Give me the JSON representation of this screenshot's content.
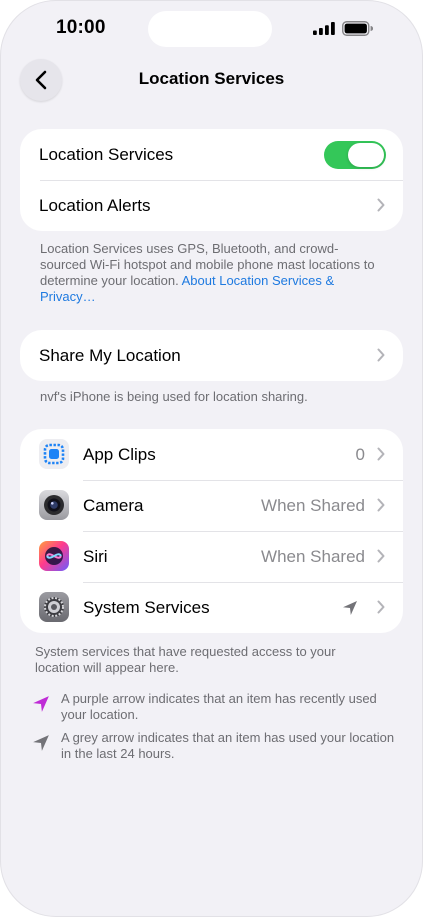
{
  "status_bar": {
    "time": "10:00"
  },
  "nav": {
    "title": "Location Services"
  },
  "location_group": {
    "toggle_label": "Location Services",
    "toggle_on": true,
    "alerts_label": "Location Alerts"
  },
  "location_note": {
    "text": "Location Services uses GPS, Bluetooth, and crowd-sourced Wi-Fi hotspot and mobile phone mast locations to determine your location. ",
    "link": "About Location Services & Privacy…"
  },
  "share": {
    "label": "Share My Location",
    "note": "nvf's iPhone is being used for location sharing."
  },
  "apps": [
    {
      "name": "App Clips",
      "value": "0",
      "icon": "app-clips-icon"
    },
    {
      "name": "Camera",
      "value": "When Shared",
      "icon": "camera-icon"
    },
    {
      "name": "Siri",
      "value": "When Shared",
      "icon": "siri-icon"
    },
    {
      "name": "System Services",
      "value": "",
      "icon": "gear-icon",
      "status_icon": "location-arrow-grey-icon"
    }
  ],
  "system_note": "System services that have requested access to your location will appear here.",
  "legend": [
    {
      "icon": "purple-arrow-icon",
      "text": "A purple arrow indicates that an item has recently used your location."
    },
    {
      "icon": "grey-arrow-icon",
      "text": "A grey arrow indicates that an item has used your location in the last 24 hours."
    }
  ],
  "colors": {
    "background": "#f2f1f6",
    "toggle_on": "#34c759",
    "link": "#1f7ae0",
    "purple_arrow": "#bf2cd6",
    "grey_arrow": "#737378"
  }
}
